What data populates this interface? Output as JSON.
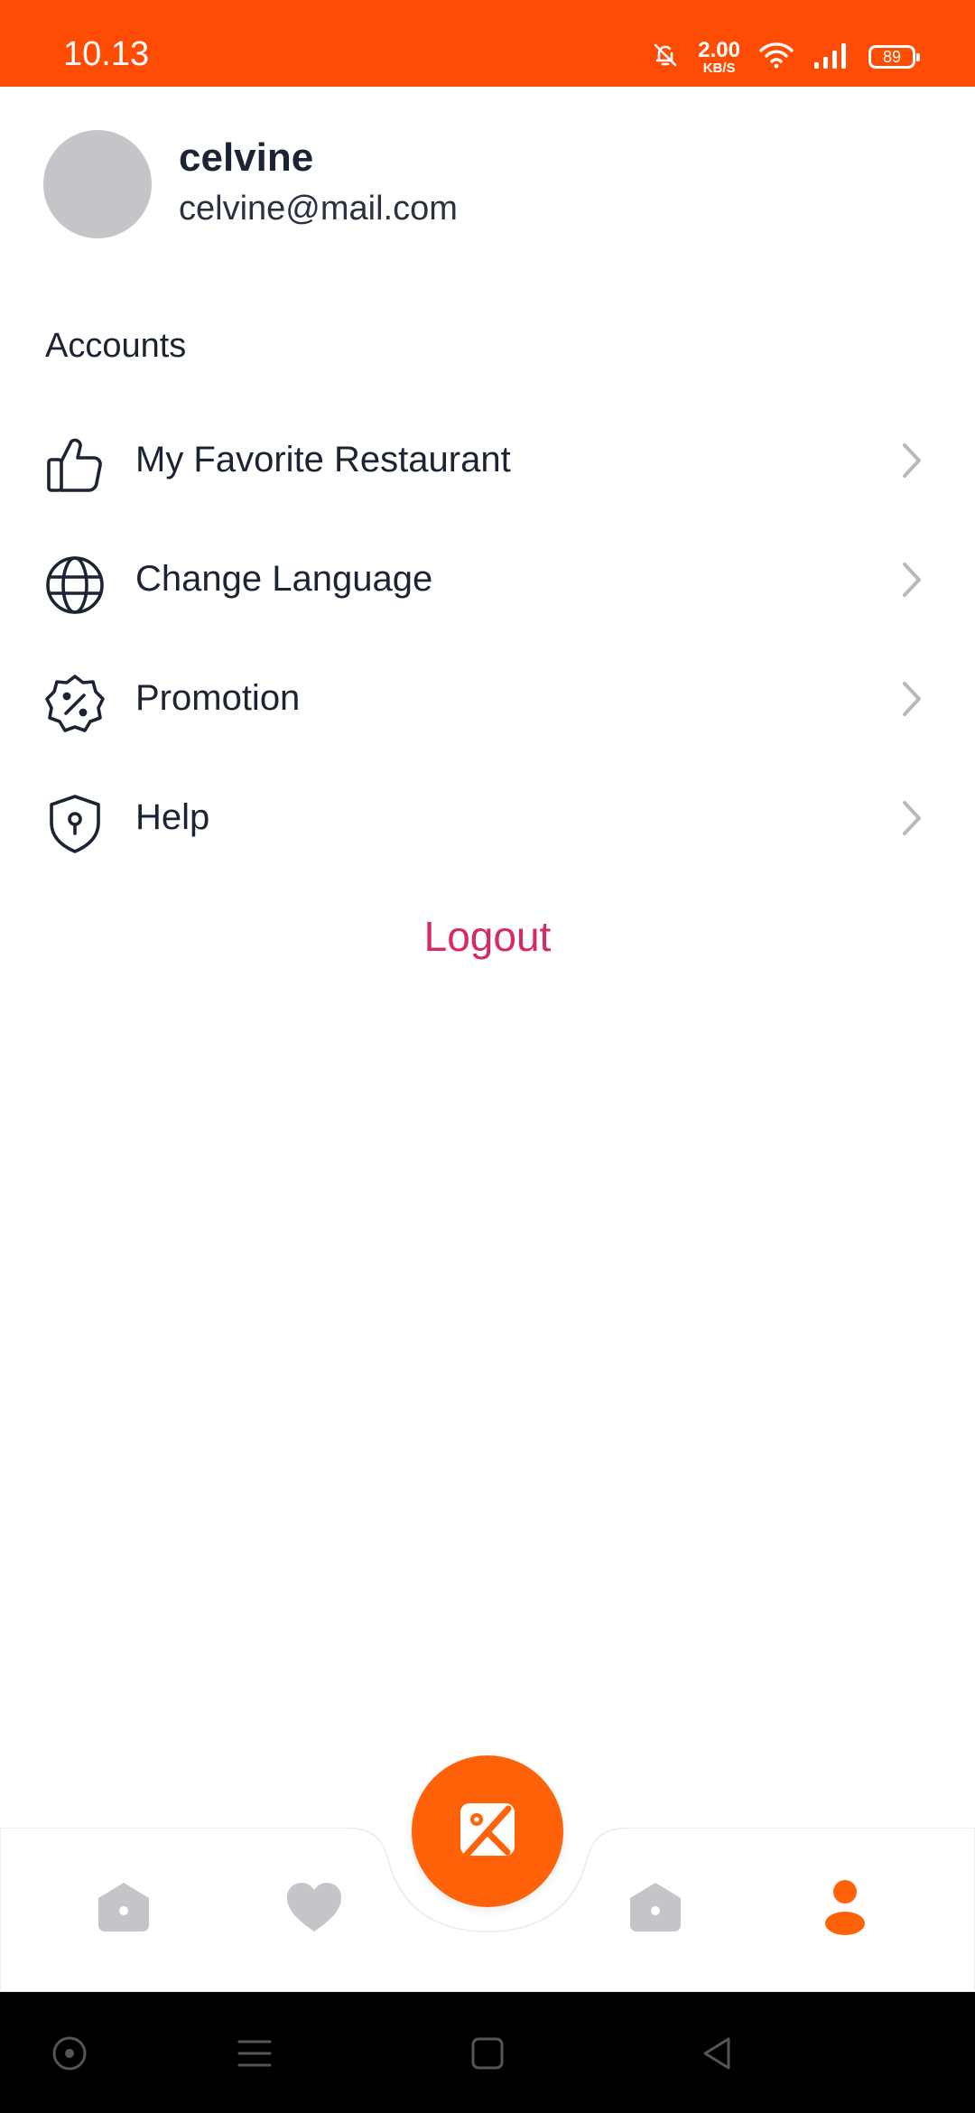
{
  "status_bar": {
    "time": "10.13",
    "speed_value": "2.00",
    "speed_unit": "KB/S",
    "battery": "89",
    "color": "#ff4c05"
  },
  "profile": {
    "name": "celvine",
    "email": "celvine@mail.com"
  },
  "accounts": {
    "title": "Accounts",
    "items": [
      {
        "label": "My Favorite Restaurant",
        "icon": "thumbs-up-icon"
      },
      {
        "label": "Change Language",
        "icon": "globe-icon"
      },
      {
        "label": "Promotion",
        "icon": "discount-badge-icon"
      },
      {
        "label": "Help",
        "icon": "shield-keyhole-icon"
      }
    ]
  },
  "logout": {
    "label": "Logout",
    "color": "#d52b61"
  },
  "bottom_nav": {
    "items": [
      {
        "icon": "home-icon",
        "active": false
      },
      {
        "icon": "heart-icon",
        "active": false
      },
      {
        "icon": "scan-image-icon",
        "active": true,
        "center": true
      },
      {
        "icon": "home-icon",
        "active": false
      },
      {
        "icon": "user-icon",
        "active": true
      }
    ],
    "accent": "#ff6209",
    "inactive": "#c4c5c9"
  },
  "system_nav": {
    "items": [
      "screen-record-icon",
      "menu-icon",
      "home-square-icon",
      "back-icon"
    ]
  }
}
